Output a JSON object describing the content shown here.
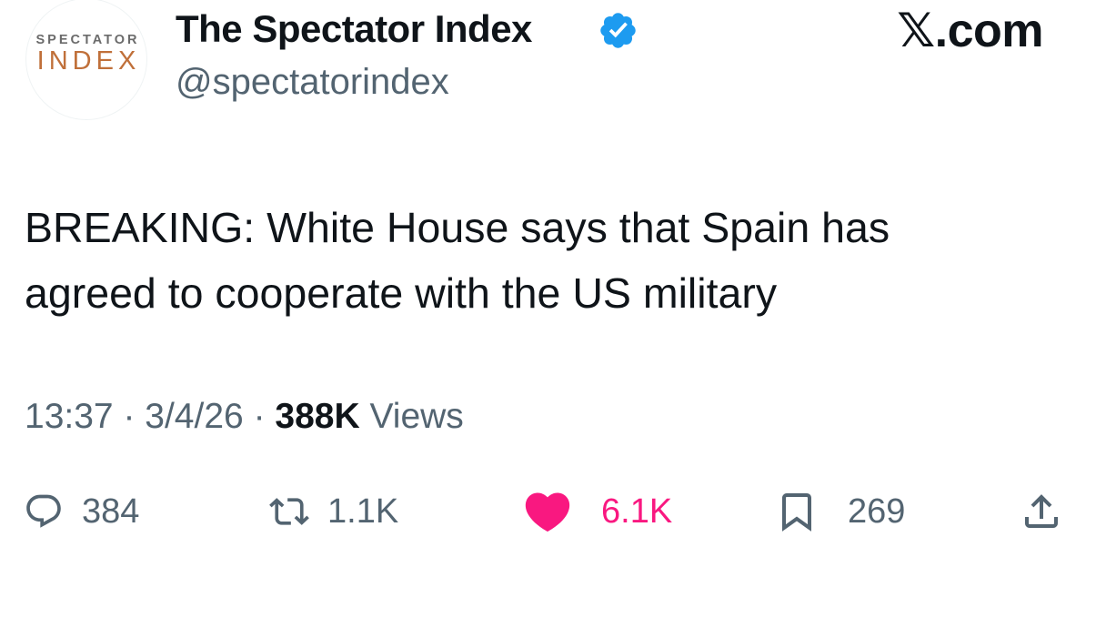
{
  "account": {
    "avatar_line1": "SPECTATOR",
    "avatar_line2": "INDEX",
    "display_name": "The Spectator Index",
    "handle": "@spectatorindex",
    "verified": true
  },
  "brand": "𝕏.com",
  "tweet": {
    "text_line1": "BREAKING: White House says that Spain has",
    "text_line2": "agreed to cooperate with the US military"
  },
  "meta": {
    "time": "13:37",
    "date": "3/4/26",
    "views_count": "388K",
    "views_label": "Views",
    "separator": "·"
  },
  "actions": {
    "replies": "384",
    "reposts": "1.1K",
    "likes": "6.1K",
    "bookmarks": "269",
    "like_color": "#f91880",
    "icon_color": "#536471"
  },
  "colors": {
    "verified_badge": "#1d9bf0",
    "text_primary": "#0f1419",
    "text_secondary": "#536471"
  }
}
